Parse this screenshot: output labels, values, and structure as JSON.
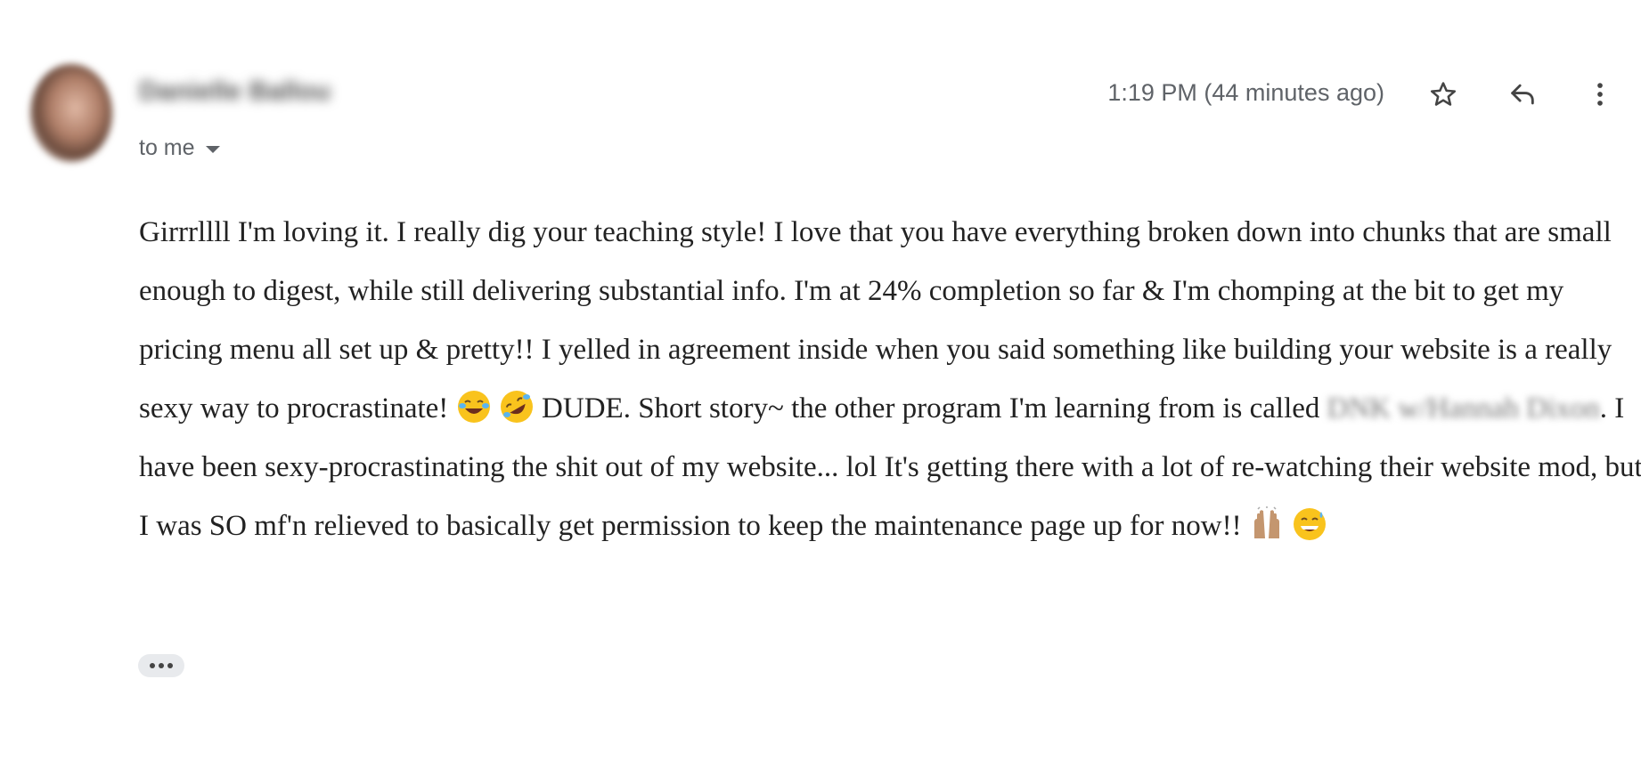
{
  "message": {
    "sender_name": "Danielle Ballou",
    "recipient_label": "to me",
    "timestamp": "1:19 PM (44 minutes ago)",
    "body": {
      "part1": "Girrrllll I'm loving it. I really dig your teaching style! I love that you have everything broken down into chunks that are small enough to digest, while still delivering substantial info. I'm at 24% completion so far & I'm chomping at the bit to get my pricing menu all set up & pretty!! I yelled in agreement inside when you said something like building your website is a really sexy way to procrastinate! ",
      "part2": " DUDE. Short story~ the other program I'm learning from is called ",
      "redacted": "DNK w/Hannah Dixon",
      "part3": ". I have been sexy-procrastinating the shit out of my website... lol It's getting there with a lot of re-watching their website mod, but I was SO mf'n relieved to basically get permission to keep the maintenance page up for now!! "
    },
    "emojis": [
      "face-with-tears-of-joy",
      "rolling-on-floor-laughing",
      "raising-hands",
      "grinning-face-with-sweat"
    ]
  },
  "actions": {
    "star_icon": "star-icon",
    "reply_icon": "reply-icon",
    "more_icon": "more-vert-icon",
    "show_trimmed_icon": "ellipsis-icon"
  },
  "colors": {
    "text": "#222222",
    "meta": "#5f6368",
    "pill": "#e8eaed",
    "emoji_yellow": "#f9c31d",
    "skin": "#c4966f"
  }
}
